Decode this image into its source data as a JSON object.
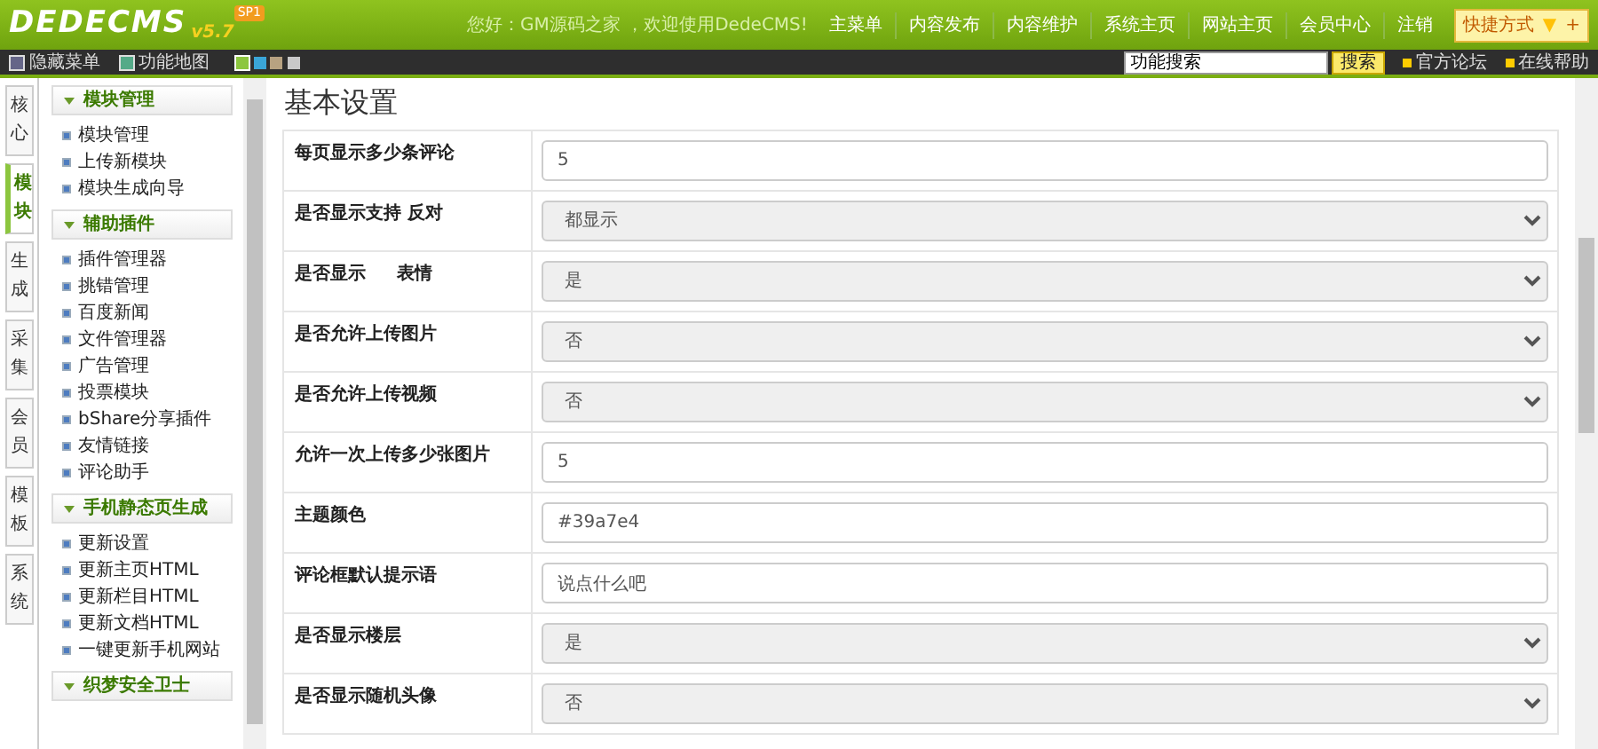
{
  "header": {
    "logo": "DEDECMS",
    "version": "v5.7",
    "badge": "SP1",
    "greeting": "您好：GM源码之家 ，欢迎使用DedeCMS!",
    "nav": [
      "主菜单",
      "内容发布",
      "内容维护",
      "系统主页",
      "网站主页",
      "会员中心",
      "注销"
    ],
    "shortcut": {
      "label": "快捷方式",
      "caret": "▼",
      "plus": "+"
    }
  },
  "toolbar": {
    "hide_menu": "隐藏菜单",
    "site_map": "功能地图",
    "themes": [
      {
        "color": "#8cc63f",
        "selected": true
      },
      {
        "color": "#3aa6d8",
        "selected": false
      },
      {
        "color": "#b7a281",
        "selected": false
      },
      {
        "color": "#c9c9c9",
        "selected": false
      }
    ],
    "search": {
      "value": "功能搜索",
      "button": "搜索"
    },
    "links": [
      "官方论坛",
      "在线帮助"
    ]
  },
  "side_tabs": [
    {
      "label": "核心",
      "selected": false
    },
    {
      "label": "模块",
      "selected": true
    },
    {
      "label": "生成",
      "selected": false
    },
    {
      "label": "采集",
      "selected": false
    },
    {
      "label": "会员",
      "selected": false
    },
    {
      "label": "模板",
      "selected": false
    },
    {
      "label": "系统",
      "selected": false
    }
  ],
  "menu_groups": [
    {
      "title": "模块管理",
      "items": [
        "模块管理",
        "上传新模块",
        "模块生成向导"
      ]
    },
    {
      "title": "辅助插件",
      "items": [
        "插件管理器",
        "挑错管理",
        "百度新闻",
        "文件管理器",
        "广告管理",
        "投票模块",
        "bShare分享插件",
        "友情链接",
        "评论助手"
      ]
    },
    {
      "title": "手机静态页生成",
      "items": [
        "更新设置",
        "更新主页HTML",
        "更新栏目HTML",
        "更新文档HTML",
        "一键更新手机网站"
      ]
    },
    {
      "title": "织梦安全卫士"
    }
  ],
  "page_title": "基本设置",
  "settings": [
    {
      "label": "每页显示多少条评论",
      "kind": "input",
      "value": "5"
    },
    {
      "label": "是否显示支持 反对",
      "kind": "select",
      "value": "都显示"
    },
    {
      "label": "是否显示     表情",
      "kind": "select",
      "value": "是"
    },
    {
      "label": "是否允许上传图片",
      "kind": "select",
      "value": "否"
    },
    {
      "label": "是否允许上传视频",
      "kind": "select",
      "value": "否"
    },
    {
      "label": "允许一次上传多少张图片",
      "kind": "input",
      "value": "5"
    },
    {
      "label": "主题颜色",
      "kind": "input",
      "value": "#39a7e4"
    },
    {
      "label": "评论框默认提示语",
      "kind": "input",
      "value": "说点什么吧"
    },
    {
      "label": "是否显示楼层",
      "kind": "select",
      "value": "是"
    },
    {
      "label": "是否显示随机头像",
      "kind": "select",
      "value": "否"
    }
  ]
}
